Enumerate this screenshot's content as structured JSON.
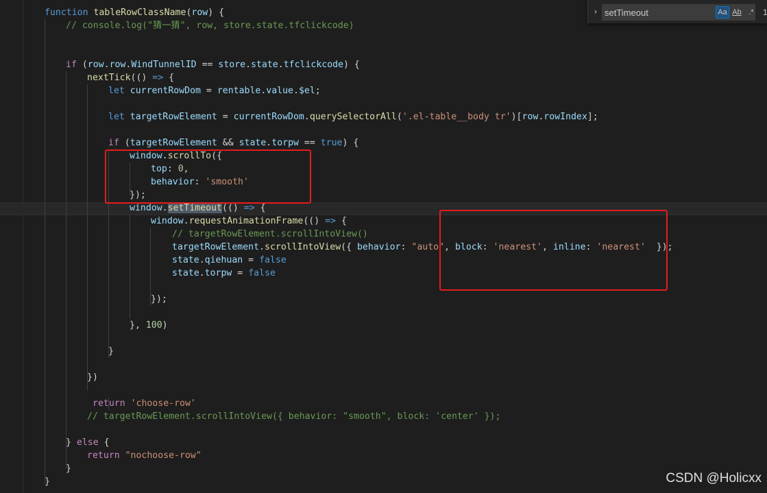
{
  "find": {
    "toggle_glyph": "›",
    "query": "setTimeout",
    "match_case": "Aa",
    "whole_word": "Ab",
    "regex": ".*",
    "result_count": "1"
  },
  "watermark": "CSDN @Holicxx",
  "code_lines": [
    [
      [
        "kw",
        "function "
      ],
      [
        "fn",
        "tableRowClassName"
      ],
      [
        "pl",
        "("
      ],
      [
        "var",
        "row"
      ],
      [
        "pl",
        ") {"
      ]
    ],
    [
      [
        "cm",
        "// console.log(\"猜一猜\", row, store.state.tfclickcode)"
      ]
    ],
    [],
    [],
    [
      [
        "ctl",
        "if "
      ],
      [
        "pl",
        "("
      ],
      [
        "var",
        "row"
      ],
      [
        "pl",
        "."
      ],
      [
        "var",
        "row"
      ],
      [
        "pl",
        "."
      ],
      [
        "var",
        "WindTunnelID"
      ],
      [
        "pl",
        " == "
      ],
      [
        "var",
        "store"
      ],
      [
        "pl",
        "."
      ],
      [
        "var",
        "state"
      ],
      [
        "pl",
        "."
      ],
      [
        "var",
        "tfclickcode"
      ],
      [
        "pl",
        ") {"
      ]
    ],
    [
      [
        "fn",
        "nextTick"
      ],
      [
        "pl",
        "(() "
      ],
      [
        "kw",
        "=>"
      ],
      [
        "pl",
        " {"
      ]
    ],
    [
      [
        "kw",
        "let "
      ],
      [
        "var",
        "currentRowDom"
      ],
      [
        "pl",
        " = "
      ],
      [
        "var",
        "rentable"
      ],
      [
        "pl",
        "."
      ],
      [
        "var",
        "value"
      ],
      [
        "pl",
        "."
      ],
      [
        "var",
        "$el"
      ],
      [
        "pl",
        ";"
      ]
    ],
    [],
    [
      [
        "kw",
        "let "
      ],
      [
        "var",
        "targetRowElement"
      ],
      [
        "pl",
        " = "
      ],
      [
        "var",
        "currentRowDom"
      ],
      [
        "pl",
        "."
      ],
      [
        "fn",
        "querySelectorAll"
      ],
      [
        "pl",
        "("
      ],
      [
        "str",
        "'.el-table__body tr'"
      ],
      [
        "pl",
        ")["
      ],
      [
        "var",
        "row"
      ],
      [
        "pl",
        "."
      ],
      [
        "var",
        "rowIndex"
      ],
      [
        "pl",
        "];"
      ]
    ],
    [],
    [
      [
        "ctl",
        "if "
      ],
      [
        "pl",
        "("
      ],
      [
        "var",
        "targetRowElement"
      ],
      [
        "pl",
        " && "
      ],
      [
        "var",
        "state"
      ],
      [
        "pl",
        "."
      ],
      [
        "var",
        "torpw"
      ],
      [
        "pl",
        " == "
      ],
      [
        "kw",
        "true"
      ],
      [
        "pl",
        ") {"
      ]
    ],
    [
      [
        "var",
        "window"
      ],
      [
        "pl",
        "."
      ],
      [
        "fn",
        "scrollTo"
      ],
      [
        "pl",
        "({"
      ]
    ],
    [
      [
        "var",
        "top"
      ],
      [
        "pl",
        ": "
      ],
      [
        "num",
        "0"
      ],
      [
        "pl",
        ","
      ]
    ],
    [
      [
        "var",
        "behavior"
      ],
      [
        "pl",
        ": "
      ],
      [
        "str",
        "'smooth'"
      ]
    ],
    [
      [
        "pl",
        "});"
      ]
    ],
    [
      [
        "var",
        "window"
      ],
      [
        "pl",
        "."
      ],
      [
        "match",
        "setTimeout"
      ],
      [
        "pl",
        "(() "
      ],
      [
        "kw",
        "=>"
      ],
      [
        "pl",
        " {"
      ]
    ],
    [
      [
        "var",
        "window"
      ],
      [
        "pl",
        "."
      ],
      [
        "fn",
        "requestAnimationFrame"
      ],
      [
        "pl",
        "(() "
      ],
      [
        "kw",
        "=>"
      ],
      [
        "pl",
        " {"
      ]
    ],
    [
      [
        "cm",
        "// targetRowElement.scrollIntoView()"
      ]
    ],
    [
      [
        "var",
        "targetRowElement"
      ],
      [
        "pl",
        "."
      ],
      [
        "fn",
        "scrollIntoView"
      ],
      [
        "pl",
        "({ "
      ],
      [
        "var",
        "behavior"
      ],
      [
        "pl",
        ": "
      ],
      [
        "str",
        "\"auto\""
      ],
      [
        "pl",
        ", "
      ],
      [
        "var",
        "block"
      ],
      [
        "pl",
        ": "
      ],
      [
        "str",
        "'nearest'"
      ],
      [
        "pl",
        ", "
      ],
      [
        "var",
        "inline"
      ],
      [
        "pl",
        ": "
      ],
      [
        "str",
        "'nearest'"
      ],
      [
        "pl",
        "  });"
      ]
    ],
    [
      [
        "var",
        "state"
      ],
      [
        "pl",
        "."
      ],
      [
        "var",
        "qiehuan"
      ],
      [
        "pl",
        " = "
      ],
      [
        "kw",
        "false"
      ]
    ],
    [
      [
        "var",
        "state"
      ],
      [
        "pl",
        "."
      ],
      [
        "var",
        "torpw"
      ],
      [
        "pl",
        " = "
      ],
      [
        "kw",
        "false"
      ]
    ],
    [],
    [
      [
        "pl",
        "});"
      ]
    ],
    [],
    [
      [
        "pl",
        "}, "
      ],
      [
        "num",
        "100"
      ],
      [
        "pl",
        ")"
      ]
    ],
    [],
    [
      [
        "pl",
        "}"
      ]
    ],
    [],
    [
      [
        "pl",
        "})"
      ]
    ],
    [],
    [
      [
        "ctl",
        "return "
      ],
      [
        "str",
        "'choose-row'"
      ]
    ],
    [
      [
        "cm",
        "// targetRowElement.scrollIntoView({ behavior: \"smooth\", block: 'center' });"
      ]
    ],
    [],
    [
      [
        "pl",
        "} "
      ],
      [
        "ctl",
        "else"
      ],
      [
        "pl",
        " {"
      ]
    ],
    [
      [
        "ctl",
        "return "
      ],
      [
        "str",
        "\"nochoose-row\""
      ]
    ],
    [
      [
        "pl",
        "}"
      ]
    ],
    [
      [
        "pl",
        "}"
      ]
    ]
  ]
}
